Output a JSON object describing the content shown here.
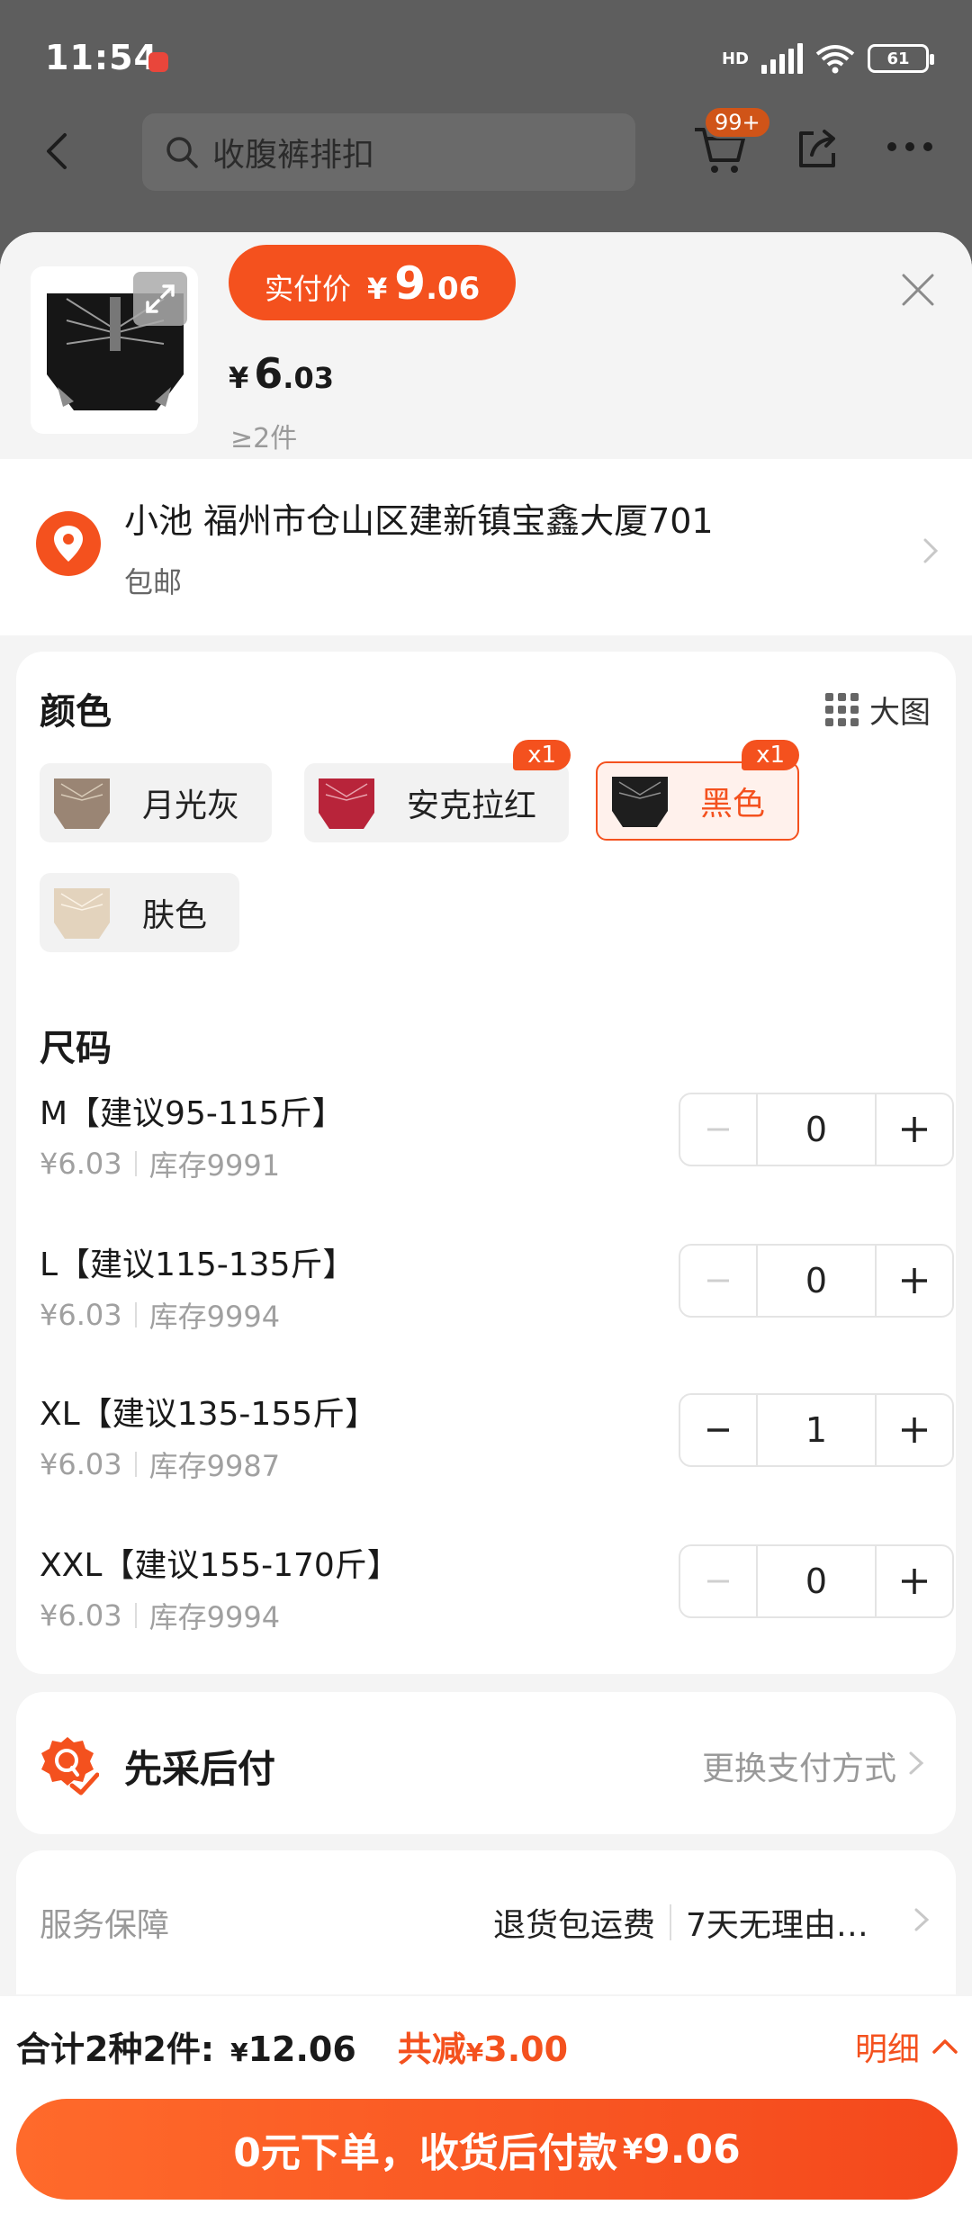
{
  "status_bar": {
    "time": "11:54",
    "network": "HD",
    "battery": "61"
  },
  "nav": {
    "search_text": "收腹裤排扣",
    "cart_badge": "99+"
  },
  "product": {
    "pill_label": "实付价",
    "pill_yen": "¥",
    "pill_int": "9",
    "pill_dec": ".06",
    "unit_yen": "¥",
    "unit_int": "6",
    "unit_dec": ".03",
    "min_qty": "≥2件"
  },
  "address": {
    "text": "小池 福州市仓山区建新镇宝鑫大厦701",
    "shipping": "包邮"
  },
  "color_section": {
    "title": "颜色",
    "big_image_label": "大图",
    "options": [
      {
        "label": "月光灰",
        "badge": "",
        "swatch": "#9a8574",
        "selected": false
      },
      {
        "label": "安克拉红",
        "badge": "x1",
        "swatch": "#b8243a",
        "selected": false
      },
      {
        "label": "黑色",
        "badge": "x1",
        "swatch": "#1e1e1e",
        "selected": true
      },
      {
        "label": "肤色",
        "badge": "",
        "swatch": "#e3d3bd",
        "selected": false
      }
    ]
  },
  "size_section": {
    "title": "尺码",
    "rows": [
      {
        "name": "M【建议95-115斤】",
        "price": "¥6.03",
        "stock": "库存9991",
        "qty": "0"
      },
      {
        "name": "L【建议115-135斤】",
        "price": "¥6.03",
        "stock": "库存9994",
        "qty": "0"
      },
      {
        "name": "XL【建议135-155斤】",
        "price": "¥6.03",
        "stock": "库存9987",
        "qty": "1"
      },
      {
        "name": "XXL【建议155-170斤】",
        "price": "¥6.03",
        "stock": "库存9994",
        "qty": "0"
      }
    ]
  },
  "payment": {
    "title": "先采后付",
    "change_label": "更换支付方式"
  },
  "service": {
    "label": "服务保障",
    "item1": "退货包运费",
    "item2": "7天无理由…"
  },
  "summary": {
    "label": "合计2种2件:",
    "total_yen": "¥",
    "total": "12.06",
    "discount_label": "共减",
    "discount_yen": "¥",
    "discount": "3.00",
    "detail_label": "明细"
  },
  "cta": {
    "label": "0元下单，收货后付款",
    "yen": "¥",
    "amount": "9.06"
  },
  "colors": {
    "accent": "#f4511e",
    "selected_bg": "#fff1ec"
  }
}
